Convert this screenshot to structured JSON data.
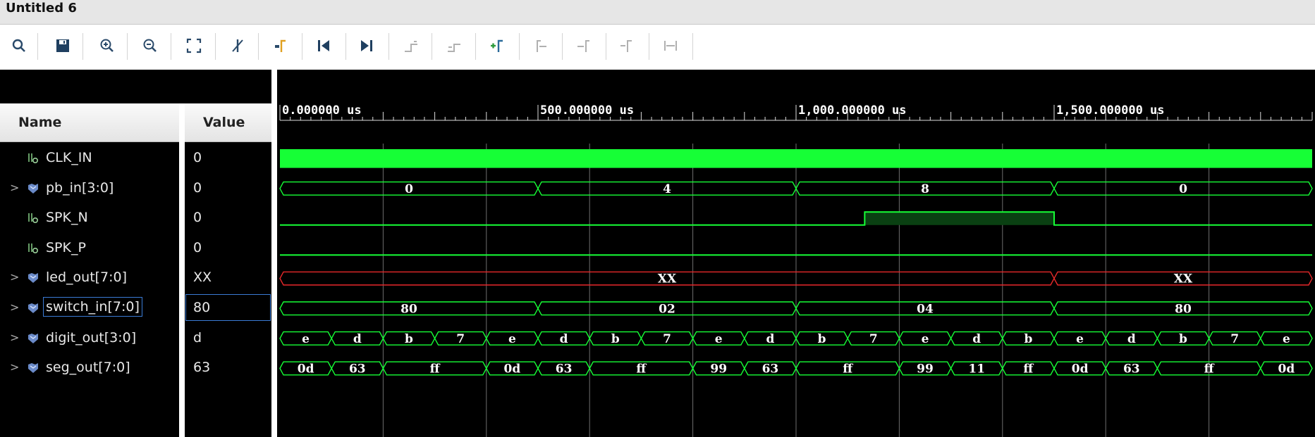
{
  "window": {
    "title": "Untitled 6"
  },
  "toolbar": {
    "icons": [
      "search-icon",
      "save-icon",
      "zoom-in-icon",
      "zoom-out-icon",
      "zoom-fit-icon",
      "cursor-off-icon",
      "go-to-cursor-icon",
      "go-to-time-0-icon",
      "go-to-last-time-icon",
      "previous-transition-icon",
      "next-transition-icon",
      "add-marker-icon",
      "previous-marker-icon",
      "next-marker-icon",
      "swap-cursors-icon",
      "fix-cursor-icon"
    ]
  },
  "columns": {
    "name": "Name",
    "value": "Value"
  },
  "signals": [
    {
      "name": "CLK_IN",
      "value": "0",
      "kind": "scalar",
      "expandable": false
    },
    {
      "name": "pb_in[3:0]",
      "value": "0",
      "kind": "bus",
      "expandable": true
    },
    {
      "name": "SPK_N",
      "value": "0",
      "kind": "scalar",
      "expandable": false
    },
    {
      "name": "SPK_P",
      "value": "0",
      "kind": "scalar",
      "expandable": false
    },
    {
      "name": "led_out[7:0]",
      "value": "XX",
      "kind": "bus",
      "expandable": true
    },
    {
      "name": "switch_in[7:0]",
      "value": "80",
      "kind": "bus",
      "expandable": true,
      "selected": true
    },
    {
      "name": "digit_out[3:0]",
      "value": "d",
      "kind": "bus",
      "expandable": true
    },
    {
      "name": "seg_out[7:0]",
      "value": "63",
      "kind": "bus",
      "expandable": true
    }
  ],
  "waveform": {
    "time_unit": "us",
    "time_range": [
      0,
      2000
    ],
    "ruler_labels": [
      {
        "t": 0,
        "text": "0.000000 us"
      },
      {
        "t": 500,
        "text": "500.000000 us"
      },
      {
        "t": 1000,
        "text": "1,000.000000 us"
      },
      {
        "t": 1500,
        "text": "1,500.000000 us"
      }
    ],
    "colors": {
      "wave": "#16ff36",
      "unknown": "#e8282a",
      "high_fill": "#0a4012",
      "background": "#000000",
      "grid": "#6e6e6e"
    },
    "tracks": [
      {
        "signal": "CLK_IN",
        "type": "clock"
      },
      {
        "signal": "pb_in[3:0]",
        "type": "bus",
        "segments": [
          [
            0,
            500,
            "0"
          ],
          [
            500,
            1000,
            "4"
          ],
          [
            1000,
            1500,
            "8"
          ],
          [
            1500,
            2000,
            "0"
          ]
        ]
      },
      {
        "signal": "SPK_N",
        "type": "bit",
        "segments": [
          [
            0,
            1133,
            0
          ],
          [
            1133,
            1500,
            1
          ],
          [
            1500,
            2000,
            0
          ]
        ]
      },
      {
        "signal": "SPK_P",
        "type": "bit",
        "segments": [
          [
            0,
            2000,
            0
          ]
        ]
      },
      {
        "signal": "led_out[7:0]",
        "type": "bus",
        "unknown": true,
        "segments": [
          [
            0,
            1500,
            "XX"
          ],
          [
            1500,
            2000,
            "XX"
          ]
        ]
      },
      {
        "signal": "switch_in[7:0]",
        "type": "bus",
        "segments": [
          [
            0,
            500,
            "80"
          ],
          [
            500,
            1000,
            "02"
          ],
          [
            1000,
            1500,
            "04"
          ],
          [
            1500,
            2000,
            "80"
          ]
        ]
      },
      {
        "signal": "digit_out[3:0]",
        "type": "bus",
        "segments": [
          [
            0,
            100,
            "e"
          ],
          [
            100,
            200,
            "d"
          ],
          [
            200,
            300,
            "b"
          ],
          [
            300,
            400,
            "7"
          ],
          [
            400,
            500,
            "e"
          ],
          [
            500,
            600,
            "d"
          ],
          [
            600,
            700,
            "b"
          ],
          [
            700,
            800,
            "7"
          ],
          [
            800,
            900,
            "e"
          ],
          [
            900,
            1000,
            "d"
          ],
          [
            1000,
            1100,
            "b"
          ],
          [
            1100,
            1200,
            "7"
          ],
          [
            1200,
            1300,
            "e"
          ],
          [
            1300,
            1400,
            "d"
          ],
          [
            1400,
            1500,
            "b"
          ],
          [
            1500,
            1600,
            "e"
          ],
          [
            1600,
            1700,
            "d"
          ],
          [
            1700,
            1800,
            "b"
          ],
          [
            1800,
            1900,
            "7"
          ],
          [
            1900,
            2000,
            "e"
          ]
        ]
      },
      {
        "signal": "seg_out[7:0]",
        "type": "bus",
        "segments": [
          [
            0,
            100,
            "0d"
          ],
          [
            100,
            200,
            "63"
          ],
          [
            200,
            400,
            "ff"
          ],
          [
            400,
            500,
            "0d"
          ],
          [
            500,
            600,
            "63"
          ],
          [
            600,
            800,
            "ff"
          ],
          [
            800,
            900,
            "99"
          ],
          [
            900,
            1000,
            "63"
          ],
          [
            1000,
            1200,
            "ff"
          ],
          [
            1200,
            1300,
            "99"
          ],
          [
            1300,
            1400,
            "11"
          ],
          [
            1400,
            1500,
            "ff"
          ],
          [
            1500,
            1600,
            "0d"
          ],
          [
            1600,
            1700,
            "63"
          ],
          [
            1700,
            1900,
            "ff"
          ],
          [
            1900,
            2000,
            "0d"
          ]
        ]
      }
    ]
  }
}
